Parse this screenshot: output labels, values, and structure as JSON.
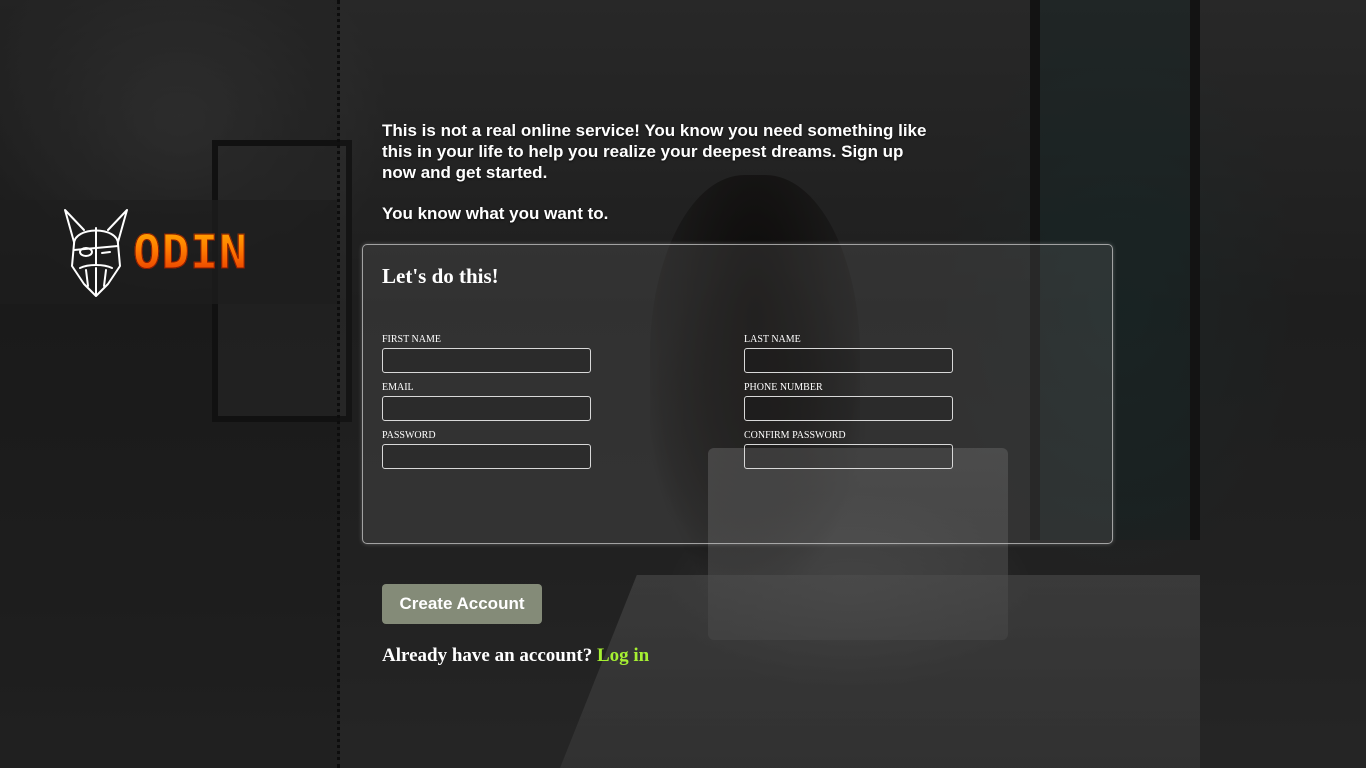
{
  "brand": {
    "name": "ODIN",
    "logo_icon": "viking-helmet-icon"
  },
  "intro": {
    "paragraph1": "This is not a real online service! You know you need something like this in your life to help you realize your deepest dreams. Sign up now and get started.",
    "paragraph2": "You know what you want to."
  },
  "form": {
    "title": "Let's do this!",
    "fields": {
      "first_name": {
        "label": "FIRST NAME",
        "value": ""
      },
      "last_name": {
        "label": "LAST NAME",
        "value": ""
      },
      "email": {
        "label": "EMAIL",
        "value": ""
      },
      "phone": {
        "label": "PHONE NUMBER",
        "value": ""
      },
      "password": {
        "label": "PASSWORD",
        "value": ""
      },
      "confirm_password": {
        "label": "CONFIRM PASSWORD",
        "value": ""
      }
    }
  },
  "actions": {
    "create_label": "Create Account",
    "login_prompt": "Already have an account?",
    "login_link": "Log in"
  },
  "colors": {
    "button_bg": "#848b78",
    "link": "#a6f032",
    "logo_orange": "#ff7a00"
  }
}
